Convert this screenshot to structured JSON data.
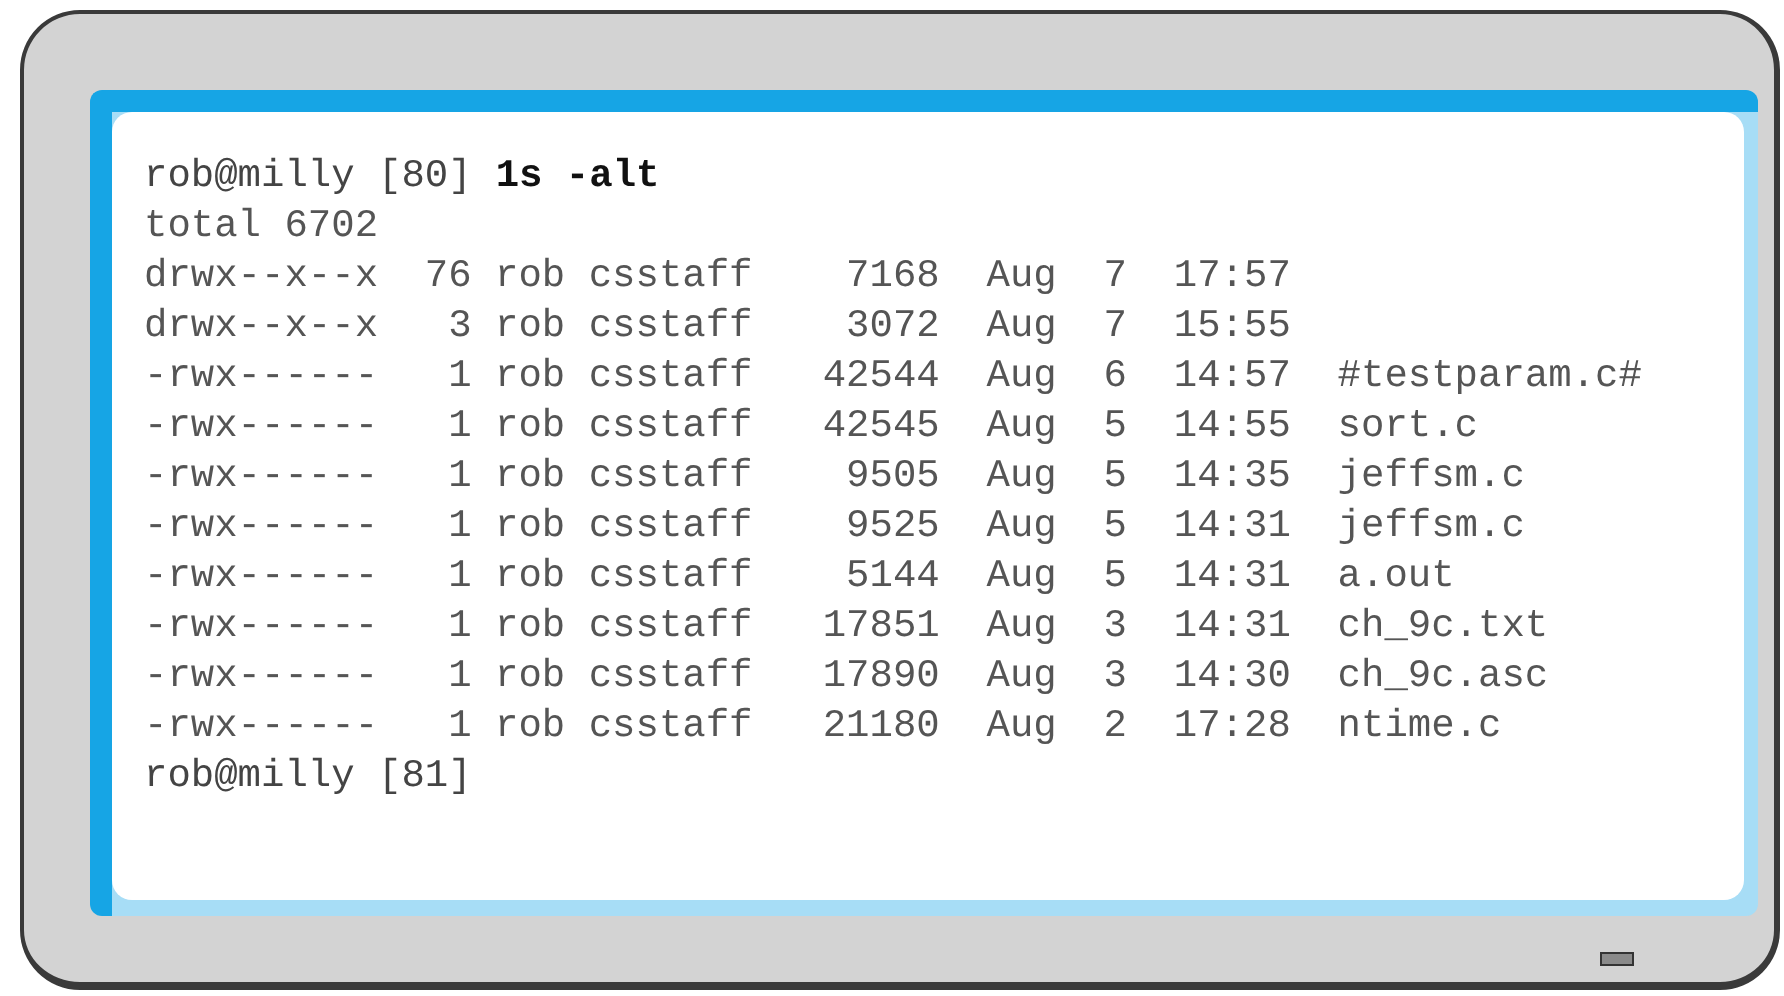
{
  "terminal": {
    "lines": [
      {
        "kind": "prompt",
        "prompt": "rob@milly [80]",
        "command": "1s -alt"
      },
      {
        "kind": "output",
        "text": "total 6702"
      },
      {
        "kind": "output",
        "text": "drwx--x--x  76 rob csstaff    7168  Aug  7  17:57"
      },
      {
        "kind": "output",
        "text": "drwx--x--x   3 rob csstaff    3072  Aug  7  15:55"
      },
      {
        "kind": "output",
        "text": "-rwx------   1 rob csstaff   42544  Aug  6  14:57  #testparam.c#"
      },
      {
        "kind": "output",
        "text": "-rwx------   1 rob csstaff   42545  Aug  5  14:55  sort.c"
      },
      {
        "kind": "output",
        "text": "-rwx------   1 rob csstaff    9505  Aug  5  14:35  jeffsm.c"
      },
      {
        "kind": "output",
        "text": "-rwx------   1 rob csstaff    9525  Aug  5  14:31  jeffsm.c"
      },
      {
        "kind": "output",
        "text": "-rwx------   1 rob csstaff    5144  Aug  5  14:31  a.out"
      },
      {
        "kind": "output",
        "text": "-rwx------   1 rob csstaff   17851  Aug  3  14:31  ch_9c.txt"
      },
      {
        "kind": "output",
        "text": "-rwx------   1 rob csstaff   17890  Aug  3  14:30  ch_9c.asc"
      },
      {
        "kind": "output",
        "text": "-rwx------   1 rob csstaff   21180  Aug  2  17:28  ntime.c"
      },
      {
        "kind": "prompt",
        "prompt": "rob@milly [81]"
      }
    ]
  }
}
